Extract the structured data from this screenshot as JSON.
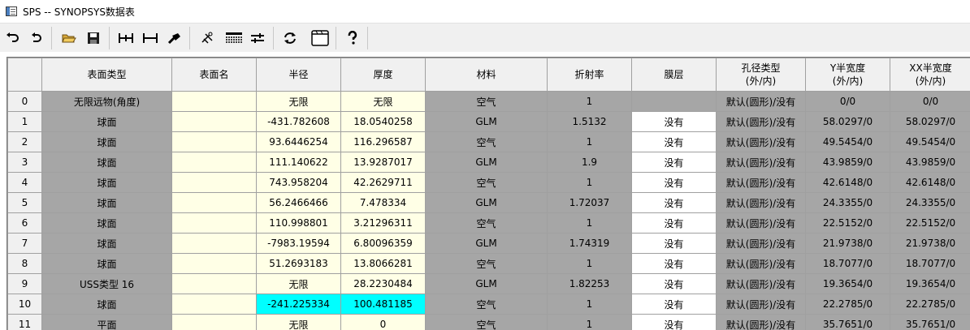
{
  "window": {
    "title": "SPS -- SYNOPSYS数据表"
  },
  "toolbar": {
    "buttons": [
      {
        "id": "undo",
        "icon": "undo-icon"
      },
      {
        "id": "redo",
        "icon": "redo-icon"
      },
      {
        "id": "open",
        "icon": "folder-open-icon"
      },
      {
        "id": "save",
        "icon": "save-icon"
      },
      {
        "id": "insert-surface",
        "icon": "insert-surface-icon"
      },
      {
        "id": "delete-surface",
        "icon": "delete-surface-icon"
      },
      {
        "id": "stop",
        "icon": "stop-icon"
      },
      {
        "id": "layout",
        "icon": "layout-icon"
      },
      {
        "id": "list",
        "icon": "list-icon"
      },
      {
        "id": "adjust",
        "icon": "adjust-icon"
      },
      {
        "id": "refresh",
        "icon": "refresh-icon"
      },
      {
        "id": "window",
        "icon": "window-icon"
      },
      {
        "id": "help",
        "icon": "help-icon"
      }
    ]
  },
  "table": {
    "headers": [
      {
        "l1": "",
        "l2": ""
      },
      {
        "l1": "表面类型",
        "l2": ""
      },
      {
        "l1": "表面名",
        "l2": ""
      },
      {
        "l1": "半径",
        "l2": ""
      },
      {
        "l1": "厚度",
        "l2": ""
      },
      {
        "l1": "材料",
        "l2": ""
      },
      {
        "l1": "折射率",
        "l2": ""
      },
      {
        "l1": "膜层",
        "l2": ""
      },
      {
        "l1": "孔径类型",
        "l2": "(外/内)"
      },
      {
        "l1": "Y半宽度",
        "l2": "(外/内)"
      },
      {
        "l1": "XX半宽度",
        "l2": "(外/内)"
      }
    ],
    "rows": [
      [
        "0",
        "无限远物(角度)",
        "",
        "无限",
        "无限",
        "空气",
        "1",
        "",
        "默认(圆形)/没有",
        "0/0",
        "0/0"
      ],
      [
        "1",
        "球面",
        "",
        "-431.782608",
        "18.0540258",
        "GLM",
        "1.5132",
        "没有",
        "默认(圆形)/没有",
        "58.0297/0",
        "58.0297/0"
      ],
      [
        "2",
        "球面",
        "",
        "93.6446254",
        "116.296587",
        "空气",
        "1",
        "没有",
        "默认(圆形)/没有",
        "49.5454/0",
        "49.5454/0"
      ],
      [
        "3",
        "球面",
        "",
        "111.140622",
        "13.9287017",
        "GLM",
        "1.9",
        "没有",
        "默认(圆形)/没有",
        "43.9859/0",
        "43.9859/0"
      ],
      [
        "4",
        "球面",
        "",
        "743.958204",
        "42.2629711",
        "空气",
        "1",
        "没有",
        "默认(圆形)/没有",
        "42.6148/0",
        "42.6148/0"
      ],
      [
        "5",
        "球面",
        "",
        "56.2466466",
        "7.478334",
        "GLM",
        "1.72037",
        "没有",
        "默认(圆形)/没有",
        "24.3355/0",
        "24.3355/0"
      ],
      [
        "6",
        "球面",
        "",
        "110.998801",
        "3.21296311",
        "空气",
        "1",
        "没有",
        "默认(圆形)/没有",
        "22.5152/0",
        "22.5152/0"
      ],
      [
        "7",
        "球面",
        "",
        "-7983.19594",
        "6.80096359",
        "GLM",
        "1.74319",
        "没有",
        "默认(圆形)/没有",
        "21.9738/0",
        "21.9738/0"
      ],
      [
        "8",
        "球面",
        "",
        "51.2693183",
        "13.8066281",
        "空气",
        "1",
        "没有",
        "默认(圆形)/没有",
        "18.7077/0",
        "18.7077/0"
      ],
      [
        "9",
        "USS类型 16",
        "",
        "无限",
        "28.2230484",
        "GLM",
        "1.82253",
        "没有",
        "默认(圆形)/没有",
        "19.3654/0",
        "19.3654/0"
      ],
      [
        "10",
        "球面",
        "",
        "-241.225334",
        "100.481185",
        "空气",
        "1",
        "没有",
        "默认(圆形)/没有",
        "22.2785/0",
        "22.2785/0"
      ],
      [
        "11",
        "平面",
        "",
        "无限",
        "0",
        "空气",
        "1",
        "没有",
        "默认(圆形)/没有",
        "35.7651/0",
        "35.7651/0"
      ]
    ],
    "selected_row": 10,
    "colors": {
      "gray_cell": "#a6a6a6",
      "editable_cell": "#ffffe6",
      "selected_cell": "#00ffff",
      "header_bg": "#f0f0f0"
    }
  }
}
